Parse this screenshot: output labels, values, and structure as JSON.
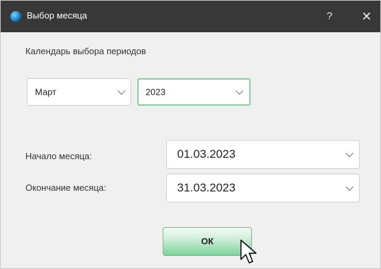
{
  "window": {
    "title": "Выбор месяца",
    "help_label": "?",
    "close_label": "✕"
  },
  "calendar": {
    "section_label": "Календарь выбора периодов",
    "month": "Март",
    "year": "2023"
  },
  "period": {
    "start_label": "Начало месяца:",
    "start_value": "01.03.2023",
    "end_label": "Окончание месяца:",
    "end_value": "31.03.2023"
  },
  "actions": {
    "ok_label": "ОК"
  },
  "icons": {
    "app": "globe-icon",
    "help": "help-icon",
    "close": "close-icon",
    "dropdown": "chevron-down-icon",
    "cursor": "mouse-pointer-icon"
  },
  "colors": {
    "titlebar": "#383838",
    "ok_button": "#7ed29a",
    "focus_border": "#8fc9a0"
  }
}
